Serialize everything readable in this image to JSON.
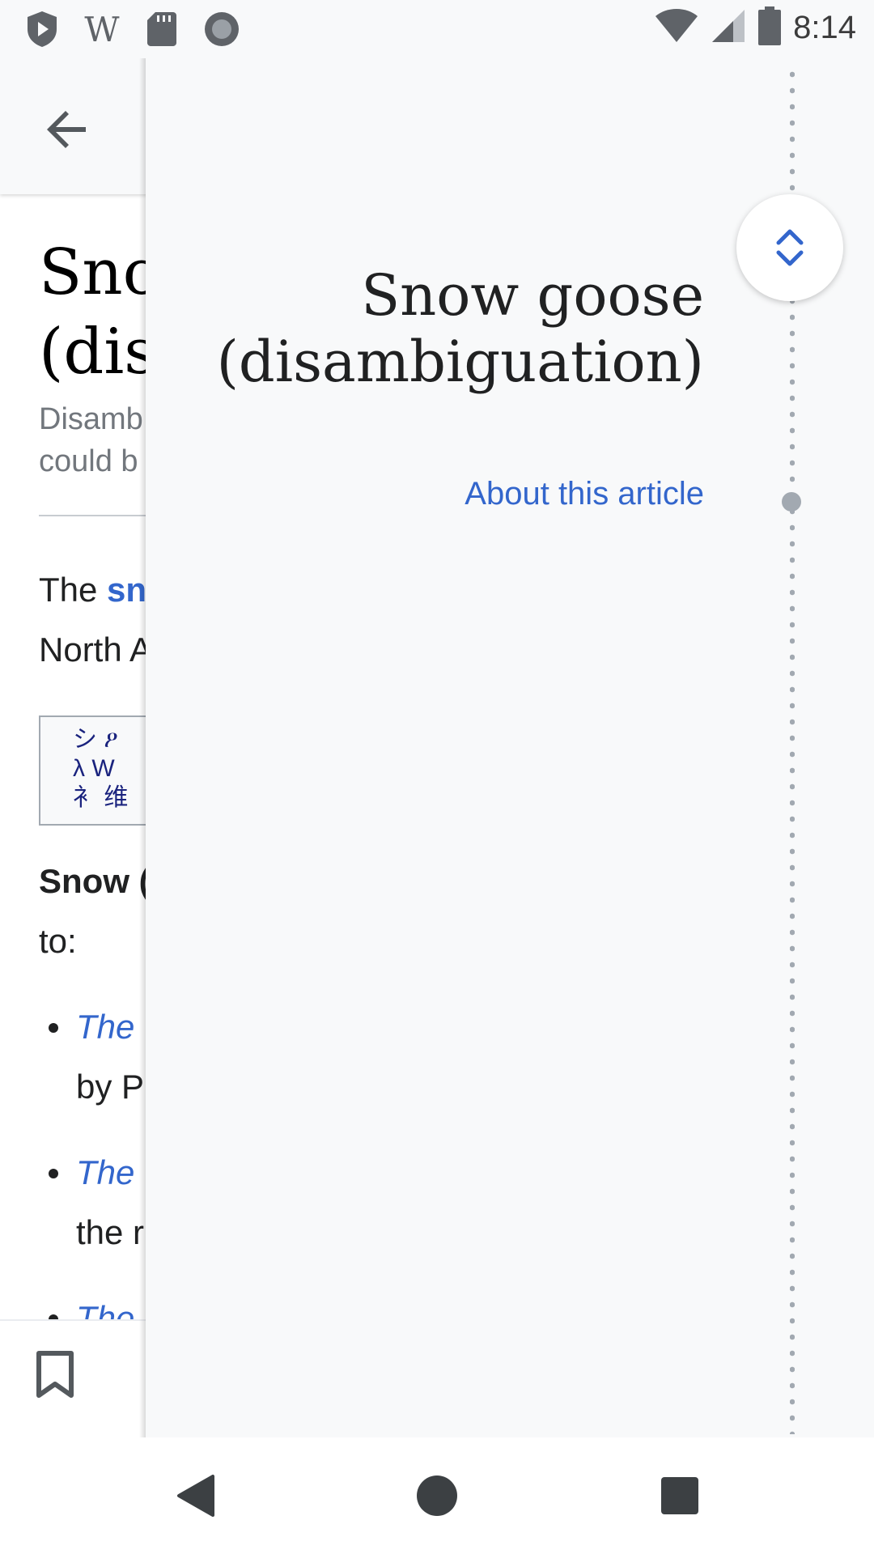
{
  "status_bar": {
    "time": "8:14",
    "icons": [
      "shield-play-icon",
      "wikipedia-icon",
      "sd-card-icon",
      "record-icon",
      "wifi-icon",
      "signal-icon",
      "battery-icon"
    ]
  },
  "article": {
    "title_visible": "Sno\n(dis",
    "description_visible": "Disamb\ncould b",
    "para_prefix": "The ",
    "para_link": "sn",
    "para_line2": "North A",
    "box_glyphs": "シ ዖ\nλ W\n衤 维",
    "bold_text": "Snow (",
    "bold_after": "to:",
    "list": [
      {
        "link": "The ",
        "rest": "by P"
      },
      {
        "link": "The ",
        "rest": "the r"
      },
      {
        "link": "The",
        "rest": ""
      }
    ]
  },
  "toc": {
    "title": "Snow goose (disambiguation)",
    "about": "About this article"
  },
  "colors": {
    "link": "#3366cc",
    "drawer_bg": "#f8f9fa",
    "marker": "#a2a9b1"
  }
}
